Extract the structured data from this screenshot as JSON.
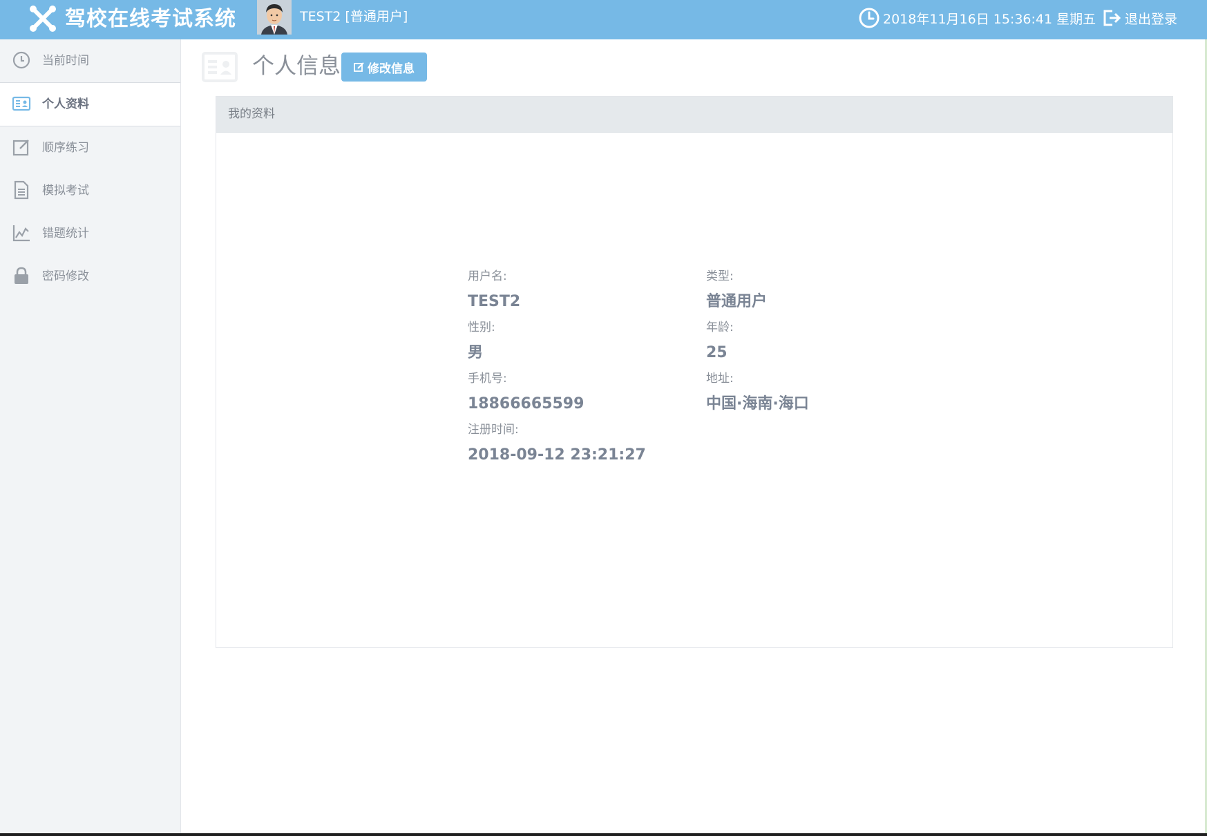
{
  "header": {
    "app_title": "驾校在线考试系统",
    "user_label": "TEST2 [普通用户]",
    "datetime": "2018年11月16日 15:36:41 星期五",
    "logout_label": "退出登录"
  },
  "sidebar": {
    "items": [
      {
        "label": "当前时间",
        "icon": "clock-icon"
      },
      {
        "label": "个人资料",
        "icon": "id-card-icon",
        "active": true
      },
      {
        "label": "顺序练习",
        "icon": "edit-square-icon"
      },
      {
        "label": "模拟考试",
        "icon": "document-icon"
      },
      {
        "label": "错题统计",
        "icon": "line-chart-icon"
      },
      {
        "label": "密码修改",
        "icon": "lock-icon"
      }
    ]
  },
  "page": {
    "title": "个人信息",
    "edit_button_label": "修改信息"
  },
  "panel": {
    "title": "我的资料",
    "fields": {
      "username": {
        "label": "用户名:",
        "value": "TEST2"
      },
      "type": {
        "label": "类型:",
        "value": "普通用户"
      },
      "gender": {
        "label": "性别:",
        "value": "男"
      },
      "age": {
        "label": "年龄:",
        "value": "25"
      },
      "phone": {
        "label": "手机号:",
        "value": "18866665599"
      },
      "address": {
        "label": "地址:",
        "value": "中国·海南·海口"
      },
      "register_time": {
        "label": "注册时间:",
        "value": "2018-09-12 23:21:27"
      }
    }
  },
  "colors": {
    "accent": "#76b9e6",
    "sidebar_bg": "#f2f4f6",
    "panel_header_bg": "#e5e9ec",
    "text_muted": "#8a9099"
  }
}
